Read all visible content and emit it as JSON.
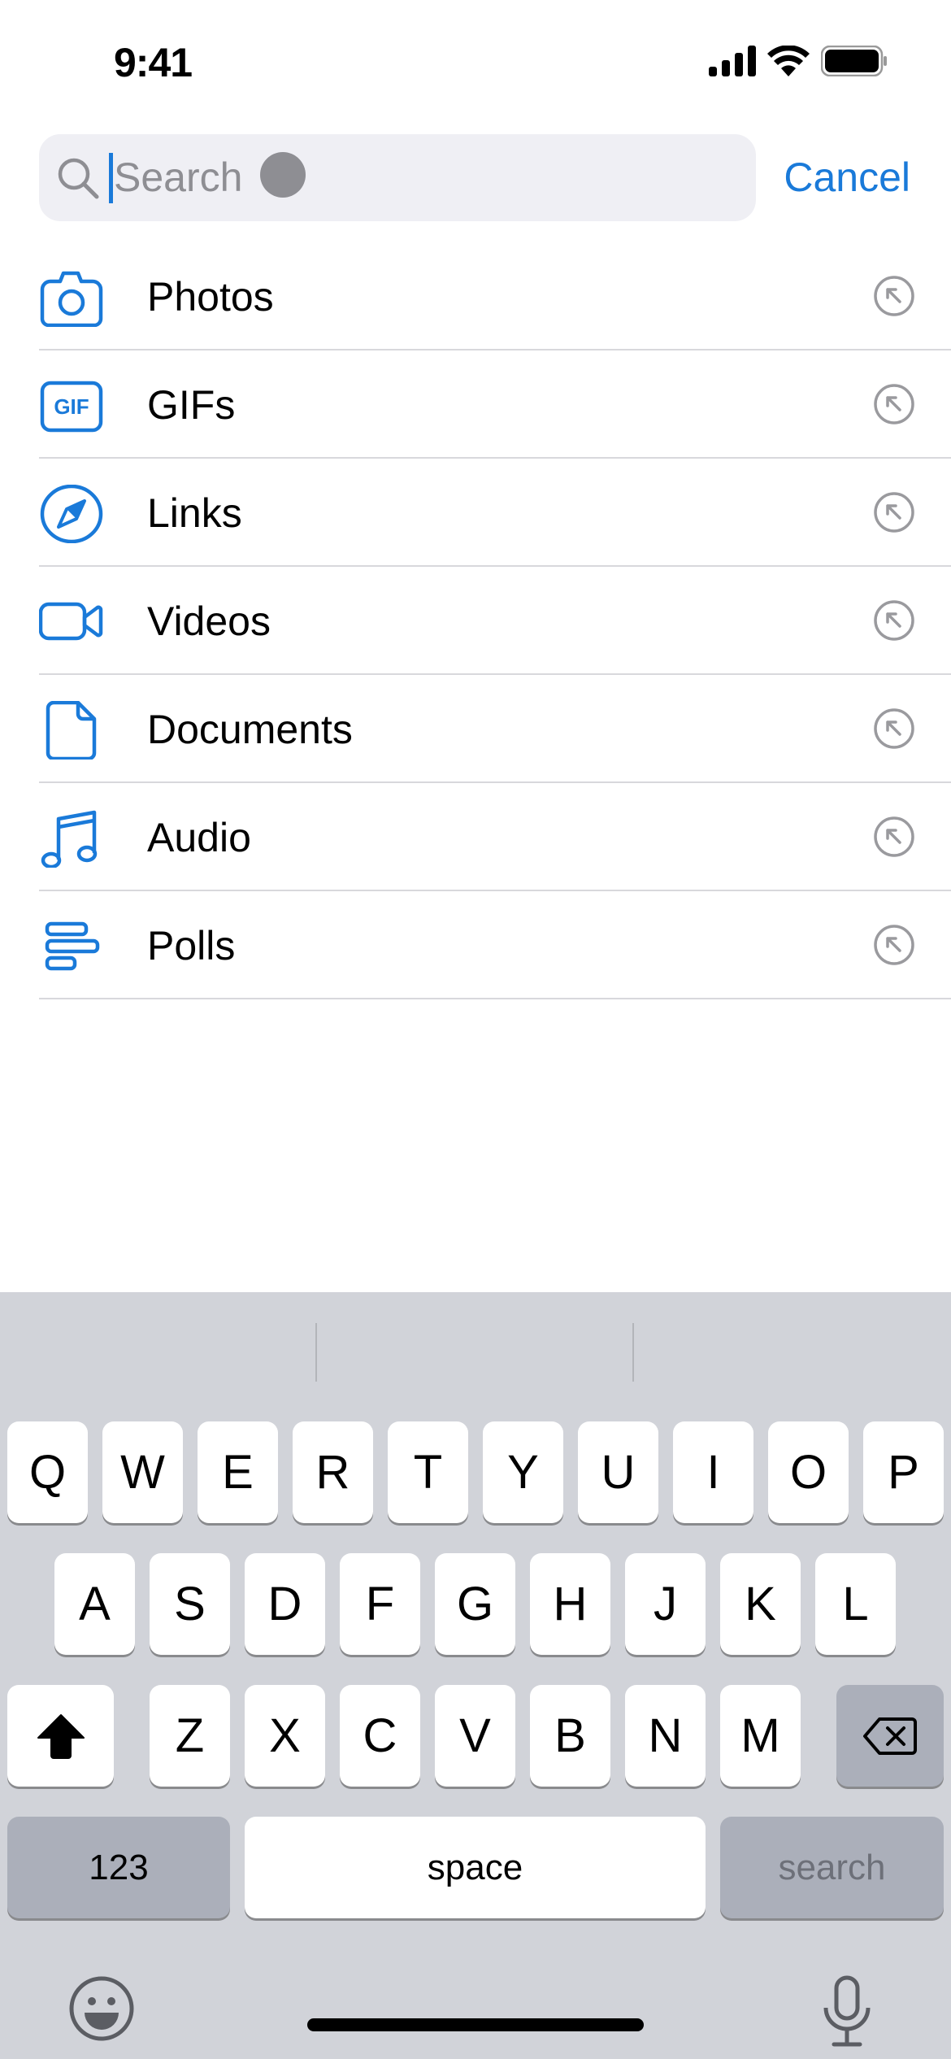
{
  "status_bar": {
    "time": "9:41",
    "icons": [
      "cellular-signal-icon",
      "wifi-icon",
      "battery-icon"
    ]
  },
  "search": {
    "placeholder": "Search",
    "value": "",
    "cancel_label": "Cancel",
    "icon": "search-icon",
    "dictation_indicator": "mic-dot"
  },
  "accent_color": "#1a7ad9",
  "categories": [
    {
      "label": "Photos",
      "icon": "camera-icon"
    },
    {
      "label": "GIFs",
      "icon": "gif-icon",
      "icon_text": "GIF"
    },
    {
      "label": "Links",
      "icon": "compass-icon"
    },
    {
      "label": "Videos",
      "icon": "video-camera-icon"
    },
    {
      "label": "Documents",
      "icon": "document-icon"
    },
    {
      "label": "Audio",
      "icon": "music-note-icon"
    },
    {
      "label": "Polls",
      "icon": "poll-icon"
    }
  ],
  "row_action_icon": "arrow-up-left-circle-icon",
  "keyboard": {
    "row1": [
      "Q",
      "W",
      "E",
      "R",
      "T",
      "Y",
      "U",
      "I",
      "O",
      "P"
    ],
    "row2": [
      "A",
      "S",
      "D",
      "F",
      "G",
      "H",
      "J",
      "K",
      "L"
    ],
    "row3": [
      "Z",
      "X",
      "C",
      "V",
      "B",
      "N",
      "M"
    ],
    "shift_icon": "shift-icon",
    "delete_icon": "delete-backward-icon",
    "numbers_label": "123",
    "space_label": "space",
    "return_label": "search",
    "emoji_icon": "emoji-icon",
    "dictation_icon": "microphone-icon"
  }
}
